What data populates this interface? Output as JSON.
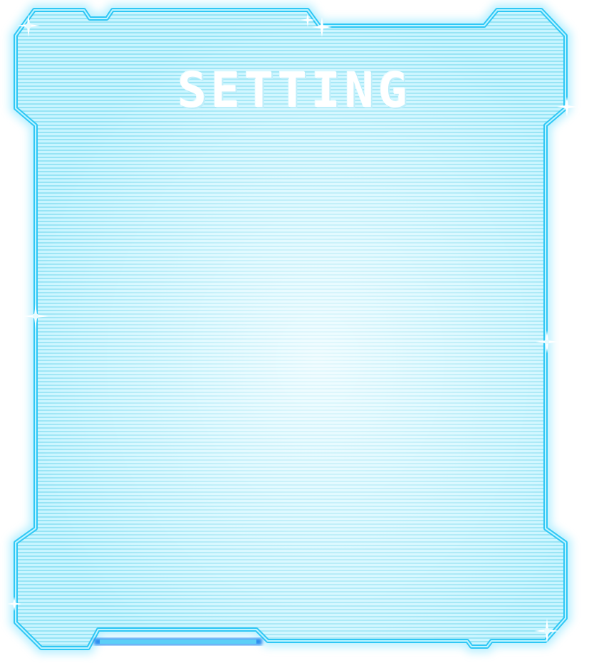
{
  "panel": {
    "title": "SETTING",
    "colors": {
      "fill": "#a9ecfa",
      "fill_light": "#dff8ff",
      "scanline": "#8fe0f4",
      "border_outer": "#2fc7f5",
      "border_inner": "#5ad8ff",
      "border_side": "#2a5fe0",
      "glow": "#c6f2ff"
    }
  }
}
